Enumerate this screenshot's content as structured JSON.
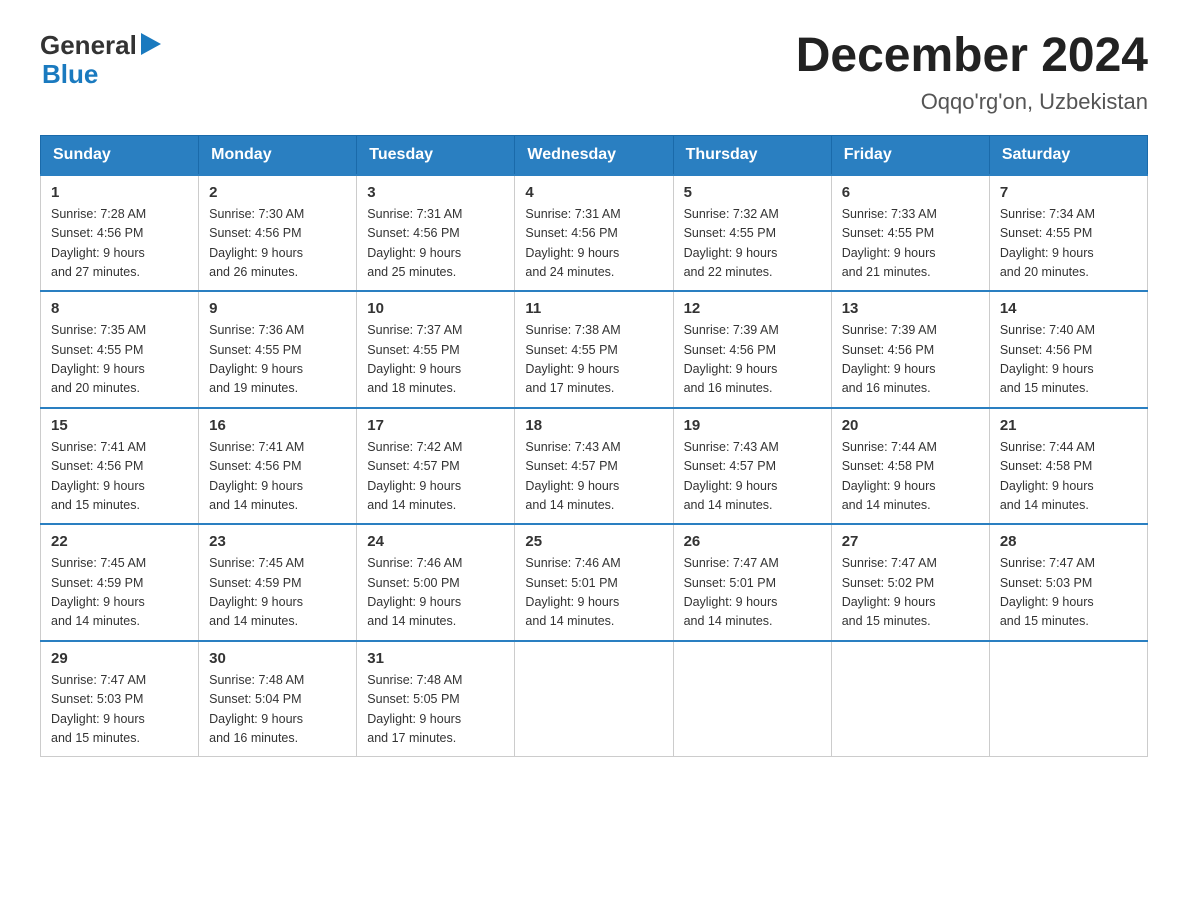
{
  "logo": {
    "general": "General",
    "blue": "Blue"
  },
  "title": "December 2024",
  "location": "Oqqo'rg'on, Uzbekistan",
  "days_of_week": [
    "Sunday",
    "Monday",
    "Tuesday",
    "Wednesday",
    "Thursday",
    "Friday",
    "Saturday"
  ],
  "weeks": [
    [
      {
        "day": "1",
        "sunrise": "7:28 AM",
        "sunset": "4:56 PM",
        "daylight": "9 hours and 27 minutes."
      },
      {
        "day": "2",
        "sunrise": "7:30 AM",
        "sunset": "4:56 PM",
        "daylight": "9 hours and 26 minutes."
      },
      {
        "day": "3",
        "sunrise": "7:31 AM",
        "sunset": "4:56 PM",
        "daylight": "9 hours and 25 minutes."
      },
      {
        "day": "4",
        "sunrise": "7:31 AM",
        "sunset": "4:56 PM",
        "daylight": "9 hours and 24 minutes."
      },
      {
        "day": "5",
        "sunrise": "7:32 AM",
        "sunset": "4:55 PM",
        "daylight": "9 hours and 22 minutes."
      },
      {
        "day": "6",
        "sunrise": "7:33 AM",
        "sunset": "4:55 PM",
        "daylight": "9 hours and 21 minutes."
      },
      {
        "day": "7",
        "sunrise": "7:34 AM",
        "sunset": "4:55 PM",
        "daylight": "9 hours and 20 minutes."
      }
    ],
    [
      {
        "day": "8",
        "sunrise": "7:35 AM",
        "sunset": "4:55 PM",
        "daylight": "9 hours and 20 minutes."
      },
      {
        "day": "9",
        "sunrise": "7:36 AM",
        "sunset": "4:55 PM",
        "daylight": "9 hours and 19 minutes."
      },
      {
        "day": "10",
        "sunrise": "7:37 AM",
        "sunset": "4:55 PM",
        "daylight": "9 hours and 18 minutes."
      },
      {
        "day": "11",
        "sunrise": "7:38 AM",
        "sunset": "4:55 PM",
        "daylight": "9 hours and 17 minutes."
      },
      {
        "day": "12",
        "sunrise": "7:39 AM",
        "sunset": "4:56 PM",
        "daylight": "9 hours and 16 minutes."
      },
      {
        "day": "13",
        "sunrise": "7:39 AM",
        "sunset": "4:56 PM",
        "daylight": "9 hours and 16 minutes."
      },
      {
        "day": "14",
        "sunrise": "7:40 AM",
        "sunset": "4:56 PM",
        "daylight": "9 hours and 15 minutes."
      }
    ],
    [
      {
        "day": "15",
        "sunrise": "7:41 AM",
        "sunset": "4:56 PM",
        "daylight": "9 hours and 15 minutes."
      },
      {
        "day": "16",
        "sunrise": "7:41 AM",
        "sunset": "4:56 PM",
        "daylight": "9 hours and 14 minutes."
      },
      {
        "day": "17",
        "sunrise": "7:42 AM",
        "sunset": "4:57 PM",
        "daylight": "9 hours and 14 minutes."
      },
      {
        "day": "18",
        "sunrise": "7:43 AM",
        "sunset": "4:57 PM",
        "daylight": "9 hours and 14 minutes."
      },
      {
        "day": "19",
        "sunrise": "7:43 AM",
        "sunset": "4:57 PM",
        "daylight": "9 hours and 14 minutes."
      },
      {
        "day": "20",
        "sunrise": "7:44 AM",
        "sunset": "4:58 PM",
        "daylight": "9 hours and 14 minutes."
      },
      {
        "day": "21",
        "sunrise": "7:44 AM",
        "sunset": "4:58 PM",
        "daylight": "9 hours and 14 minutes."
      }
    ],
    [
      {
        "day": "22",
        "sunrise": "7:45 AM",
        "sunset": "4:59 PM",
        "daylight": "9 hours and 14 minutes."
      },
      {
        "day": "23",
        "sunrise": "7:45 AM",
        "sunset": "4:59 PM",
        "daylight": "9 hours and 14 minutes."
      },
      {
        "day": "24",
        "sunrise": "7:46 AM",
        "sunset": "5:00 PM",
        "daylight": "9 hours and 14 minutes."
      },
      {
        "day": "25",
        "sunrise": "7:46 AM",
        "sunset": "5:01 PM",
        "daylight": "9 hours and 14 minutes."
      },
      {
        "day": "26",
        "sunrise": "7:47 AM",
        "sunset": "5:01 PM",
        "daylight": "9 hours and 14 minutes."
      },
      {
        "day": "27",
        "sunrise": "7:47 AM",
        "sunset": "5:02 PM",
        "daylight": "9 hours and 15 minutes."
      },
      {
        "day": "28",
        "sunrise": "7:47 AM",
        "sunset": "5:03 PM",
        "daylight": "9 hours and 15 minutes."
      }
    ],
    [
      {
        "day": "29",
        "sunrise": "7:47 AM",
        "sunset": "5:03 PM",
        "daylight": "9 hours and 15 minutes."
      },
      {
        "day": "30",
        "sunrise": "7:48 AM",
        "sunset": "5:04 PM",
        "daylight": "9 hours and 16 minutes."
      },
      {
        "day": "31",
        "sunrise": "7:48 AM",
        "sunset": "5:05 PM",
        "daylight": "9 hours and 17 minutes."
      },
      null,
      null,
      null,
      null
    ]
  ],
  "labels": {
    "sunrise": "Sunrise:",
    "sunset": "Sunset:",
    "daylight": "Daylight:"
  }
}
